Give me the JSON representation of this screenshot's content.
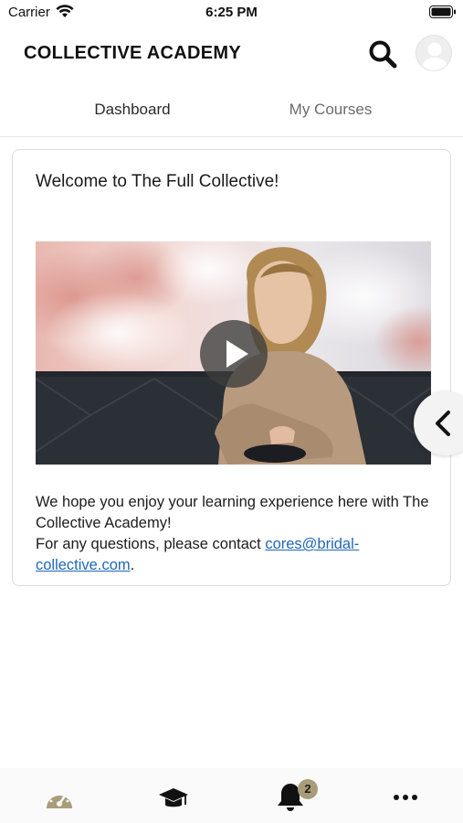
{
  "status_bar": {
    "carrier": "Carrier",
    "time": "6:25 PM"
  },
  "header": {
    "title": "COLLECTIVE ACADEMY"
  },
  "tabs": [
    {
      "label": "Dashboard"
    },
    {
      "label": "My Courses"
    }
  ],
  "welcome_card": {
    "title": "Welcome to The Full Collective!",
    "body_line1": "We hope you enjoy your learning experience here with The Collective Academy!",
    "body_line2_prefix": "For any questions, please contact ",
    "contact_link": "cores@bridal-collective.com",
    "body_line2_suffix": "."
  },
  "bottom_nav": {
    "items": [
      {
        "icon": "speedometer-icon"
      },
      {
        "icon": "graduation-cap-icon"
      },
      {
        "icon": "bell-icon",
        "badge": "2"
      },
      {
        "icon": "more-icon"
      }
    ]
  },
  "colors": {
    "accent": "#a89d7a",
    "link": "#1f67b8"
  }
}
